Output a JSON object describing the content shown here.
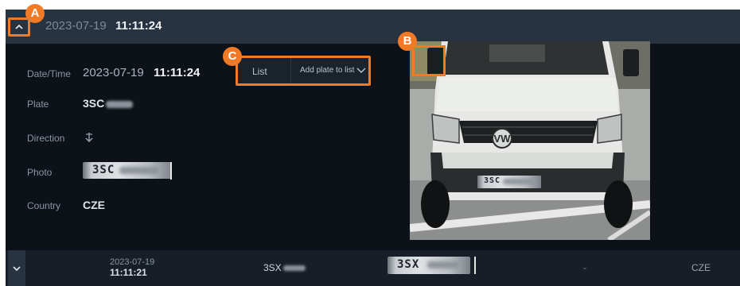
{
  "header": {
    "collapse_icon": "^",
    "date": "2023-07-19",
    "time": "11:11:24"
  },
  "badges": {
    "a": "A",
    "b": "B",
    "c": "C"
  },
  "detail": {
    "datetime_label": "Date/Time",
    "date": "2023-07-19",
    "time": "11:11:24",
    "plate_label": "Plate",
    "plate_value": "3SC",
    "direction_label": "Direction",
    "direction_icon": "approaching-direction-icon",
    "photo_label": "Photo",
    "photo_plate_text": "3SC",
    "country_label": "Country",
    "country_value": "CZE"
  },
  "list_control": {
    "label": "List",
    "select_value": "Add plate to list"
  },
  "vehicle_photo": {
    "plate_text": "3SC"
  },
  "row": {
    "date": "2023-07-19",
    "time": "11:11:21",
    "plate": "3SX",
    "plate_image_text": "3SX",
    "direction": "-",
    "country": "CZE"
  },
  "colors": {
    "accent": "#f07a25",
    "panel_bg": "#0c1117",
    "header_bg": "#273341"
  }
}
